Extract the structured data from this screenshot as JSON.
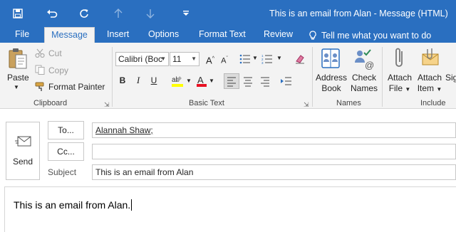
{
  "window": {
    "title": "This is an email from Alan - Message (HTML)"
  },
  "quick_access": {
    "icons": [
      "save-icon",
      "undo-icon",
      "redo-icon",
      "up-arrow-icon",
      "down-arrow-icon",
      "customize-icon"
    ]
  },
  "tabs": [
    {
      "label": "File"
    },
    {
      "label": "Message"
    },
    {
      "label": "Insert"
    },
    {
      "label": "Options"
    },
    {
      "label": "Format Text"
    },
    {
      "label": "Review"
    },
    {
      "label": "Tell me what you want to do"
    }
  ],
  "clipboard": {
    "paste": "Paste",
    "cut": "Cut",
    "copy": "Copy",
    "format_painter": "Format Painter",
    "group": "Clipboard"
  },
  "basic_text": {
    "font": "Calibri (Boc",
    "size": "11",
    "group": "Basic Text"
  },
  "names": {
    "address_book_1": "Address",
    "address_book_2": "Book",
    "check_names_1": "Check",
    "check_names_2": "Names",
    "group": "Names"
  },
  "include": {
    "attach_file_1": "Attach",
    "attach_file_2": "File",
    "attach_item_1": "Attach",
    "attach_item_2": "Item",
    "signature": "Sig",
    "group": "Include"
  },
  "compose": {
    "send": "Send",
    "to_label": "To...",
    "cc_label": "Cc...",
    "subject_label": "Subject",
    "to_value": "Alannah Shaw;",
    "cc_value": "",
    "subject_value": "This is an email from Alan",
    "body": "This is an email from Alan."
  },
  "colors": {
    "accent": "#2a6fc0",
    "ribbon": "#f3f3f3"
  }
}
